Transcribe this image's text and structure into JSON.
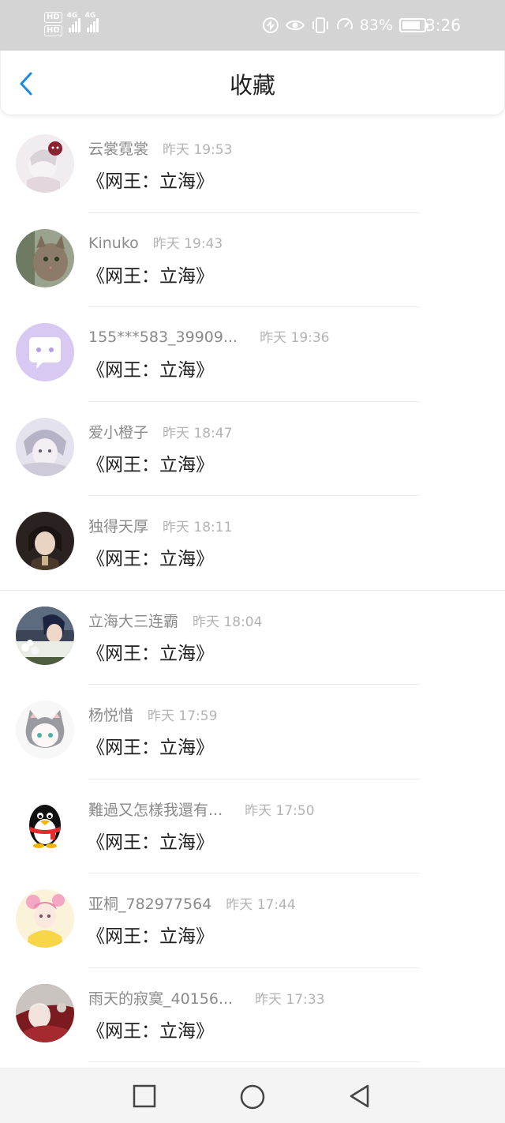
{
  "status_bar": {
    "hd1": "HD",
    "hd2": "HD",
    "network1": "4G",
    "network2": "4G",
    "battery_percent": "83%",
    "battery_level": 0.83,
    "time": "3:26",
    "icons": [
      "hd-icon",
      "signal-icon",
      "nfc-icon",
      "eye-icon",
      "vibrate-icon",
      "speed-icon",
      "battery-icon"
    ]
  },
  "header": {
    "title": "收藏",
    "back_icon": "chevron-left-icon",
    "accent": "#1a8ae5"
  },
  "favorites": [
    {
      "name": "云裳霓裳",
      "time": "昨天 19:53",
      "title": "《网王：立海》"
    },
    {
      "name": "Kinuko",
      "time": "昨天 19:43",
      "title": "《网王：立海》"
    },
    {
      "name": "155***583_39909...",
      "time": "昨天 19:36",
      "title": "《网王：立海》"
    },
    {
      "name": "爱小橙子",
      "time": "昨天 18:47",
      "title": "《网王：立海》"
    },
    {
      "name": "独得天厚",
      "time": "昨天 18:11",
      "title": "《网王：立海》"
    },
    {
      "name": "立海大三连霸",
      "time": "昨天 18:04",
      "title": "《网王：立海》"
    },
    {
      "name": "杨悦惜",
      "time": "昨天 17:59",
      "title": "《网王：立海》"
    },
    {
      "name": "難過又怎樣我還有...",
      "time": "昨天 17:50",
      "title": "《网王：立海》"
    },
    {
      "name": "亚桐_782977564",
      "time": "昨天 17:44",
      "title": "《网王：立海》"
    },
    {
      "name": "雨天的寂寞_40156...",
      "time": "昨天 17:33",
      "title": "《网王：立海》"
    }
  ],
  "system_nav": {
    "recents_icon": "square-icon",
    "home_icon": "circle-icon",
    "back_icon": "triangle-back-icon"
  }
}
